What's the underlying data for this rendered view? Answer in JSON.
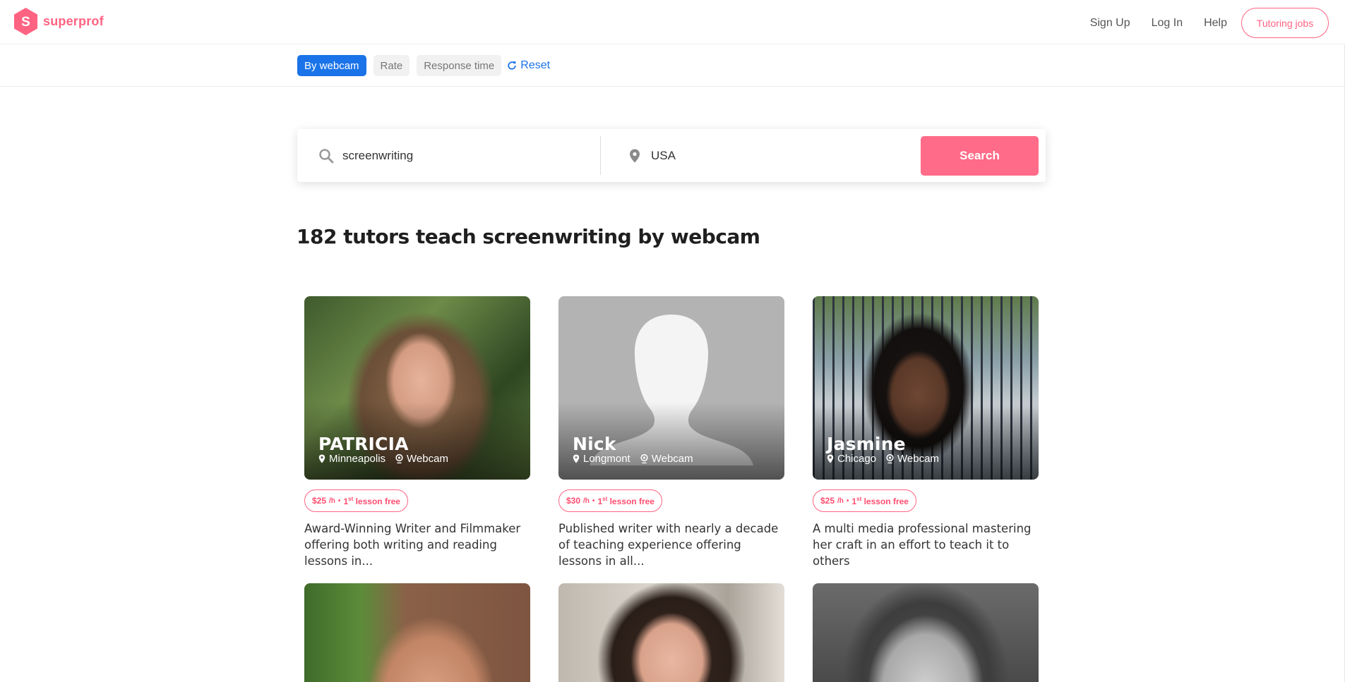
{
  "brand": {
    "name": "superprof",
    "mark_letter": "S",
    "color": "#ff6382"
  },
  "nav": {
    "sign_up": "Sign Up",
    "log_in": "Log In",
    "help": "Help",
    "tutoring_jobs": "Tutoring jobs"
  },
  "filters": {
    "chips": [
      "By webcam",
      "Rate",
      "Response time"
    ],
    "active": "By webcam",
    "reset_label": "Reset"
  },
  "search": {
    "subject_value": "screenwriting",
    "location_value": "USA",
    "button_label": "Search"
  },
  "results_title": "182 tutors teach screenwriting by webcam",
  "tutors": [
    {
      "name": "PATRICIA",
      "city": "Minneapolis",
      "mode": "Webcam",
      "price": "$25",
      "unit": "/h",
      "bullet": "•",
      "free_lesson_num": "1",
      "free_lesson_sup": "st",
      "free_lesson_text": "lesson free",
      "description": "Award-Winning Writer and Filmmaker offering both writing and reading lessons in..."
    },
    {
      "name": "Nick",
      "city": "Longmont",
      "mode": "Webcam",
      "price": "$30",
      "unit": "/h",
      "bullet": "•",
      "free_lesson_num": "1",
      "free_lesson_sup": "st",
      "free_lesson_text": "lesson free",
      "description": "Published writer with nearly a decade of teaching experience offering lessons in all..."
    },
    {
      "name": "Jasmine",
      "city": "Chicago",
      "mode": "Webcam",
      "price": "$25",
      "unit": "/h",
      "bullet": "•",
      "free_lesson_num": "1",
      "free_lesson_sup": "st",
      "free_lesson_text": "lesson free",
      "description": "A multi media professional mastering her craft in an effort to teach it to others"
    }
  ],
  "colors": {
    "accent_pink": "#ff6382",
    "accent_blue": "#1a73e8",
    "search_button": "#ff6b88"
  }
}
